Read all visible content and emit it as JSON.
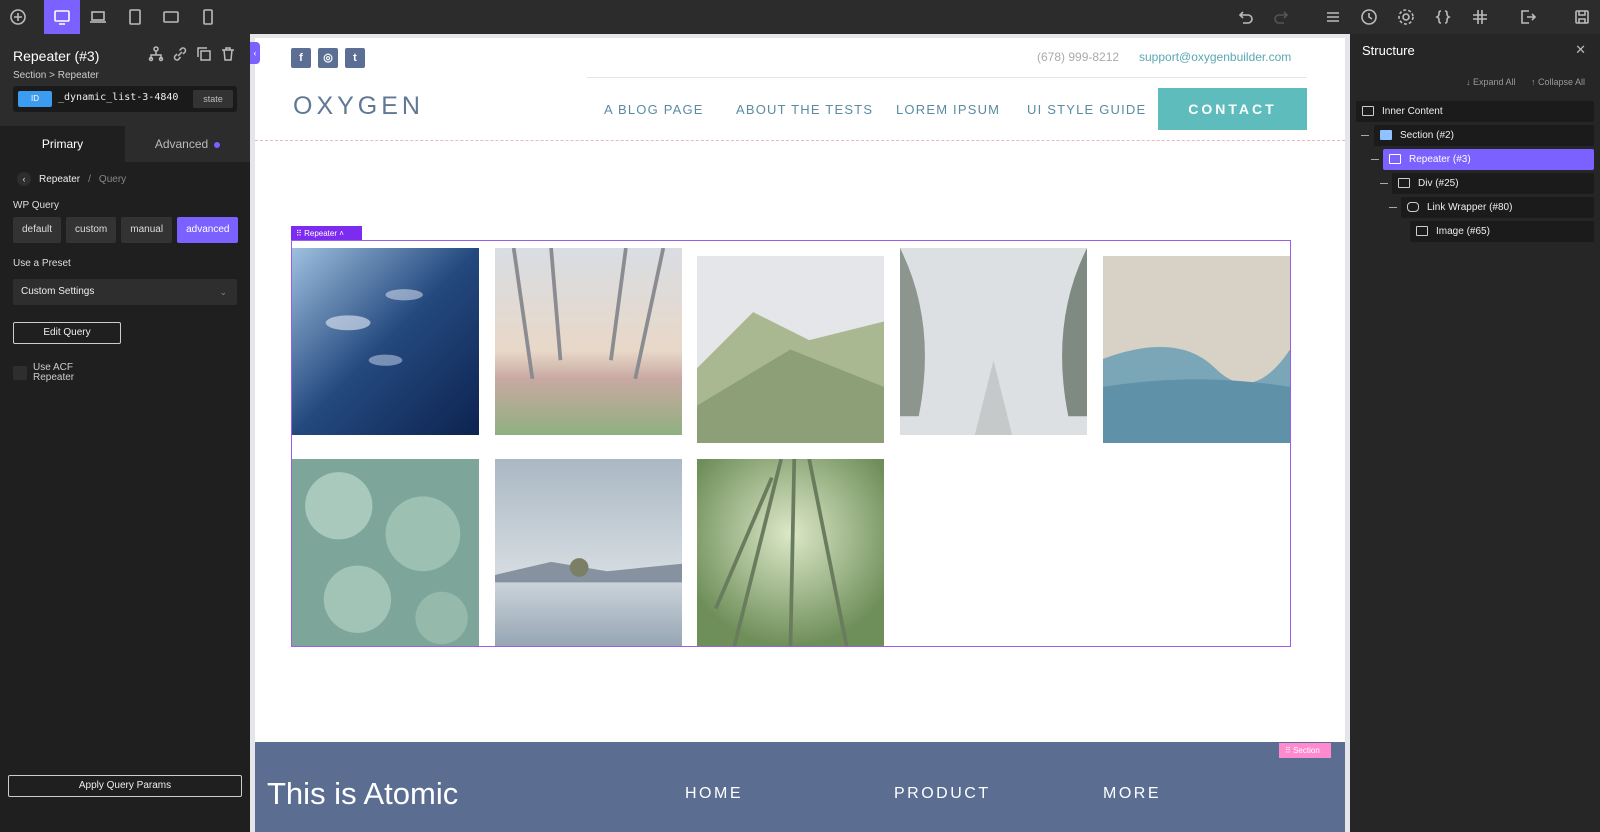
{
  "toolbar": {
    "left_icons": [
      "add-icon",
      "desktop-icon",
      "laptop-icon",
      "tablet-icon",
      "tablet-landscape-icon",
      "phone-icon"
    ],
    "right_icons": [
      "undo-icon",
      "redo-icon",
      "list-icon",
      "history-icon",
      "settings-icon",
      "code-icon",
      "grid-icon",
      "exit-icon",
      "save-icon"
    ],
    "active_device": "desktop"
  },
  "left_panel": {
    "element_title": "Repeater (#3)",
    "breadcrumb": "Section > Repeater",
    "id_badge": "ID",
    "id_value": "_dynamic_list-3-4840",
    "state_label": "state",
    "tabs": {
      "primary": "Primary",
      "advanced": "Advanced"
    },
    "sub_breadcrumb": {
      "current": "Repeater",
      "sep": "/",
      "next": "Query"
    },
    "wp_query_label": "WP Query",
    "wp_query_options": [
      "default",
      "custom",
      "manual",
      "advanced"
    ],
    "wp_query_selected": "advanced",
    "preset_label": "Use a Preset",
    "preset_value": "Custom Settings",
    "edit_query": "Edit Query",
    "acf_label": "Use ACF Repeater",
    "apply_button": "Apply Query Params"
  },
  "canvas": {
    "phone": "(678) 999-8212",
    "email": "support@oxygenbuilder.com",
    "logo": "OXYGEN",
    "nav": [
      "A BLOG PAGE",
      "ABOUT THE TESTS",
      "LOREM IPSUM",
      "UI STYLE GUIDE"
    ],
    "cta": "CONTACT",
    "repeater_tag": "Repeater",
    "footer_title": "This is Atomic",
    "footer_nav": [
      "HOME",
      "PRODUCT",
      "MORE"
    ],
    "section_tag": "Section",
    "images": [
      "koi-fish",
      "tree-lined-path",
      "mountain-ridge",
      "foggy-road",
      "coastline",
      "succulents",
      "lake-tree",
      "bamboo-forest"
    ]
  },
  "right_panel": {
    "title": "Structure",
    "expand_all": "↓ Expand All",
    "collapse_all": "↑ Collapse All",
    "tree": [
      "Inner Content",
      "Section (#2)",
      "Repeater (#3)",
      "Div (#25)",
      "Link Wrapper (#80)",
      "Image (#65)"
    ],
    "selected": "Repeater (#3)"
  },
  "colors": {
    "accent": "#7b61ff",
    "cta": "#5fbcbd",
    "footer": "#5b6e92",
    "section_tag": "#ff8ad0"
  }
}
